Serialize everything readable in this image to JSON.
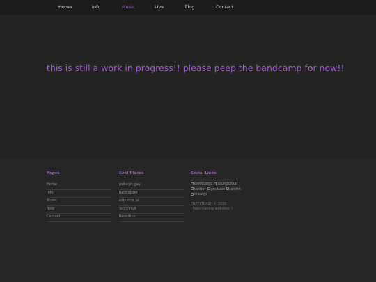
{
  "nav": {
    "items": [
      {
        "label": "Home",
        "active": false
      },
      {
        "label": "Info",
        "active": false
      },
      {
        "label": "Music",
        "active": true
      },
      {
        "label": "Live",
        "active": false
      },
      {
        "label": "Blog",
        "active": false
      },
      {
        "label": "Contact",
        "active": false
      }
    ]
  },
  "hero": {
    "text": "this is still a work in progress!! please peep the bandcamp for now!!"
  },
  "footer": {
    "pages": {
      "title": "Pages",
      "items": [
        "Home",
        "Info",
        "Music",
        "Blog",
        "Contact"
      ]
    },
    "cool_places": {
      "title": "Cool Places",
      "items": [
        "psikeyis.gay",
        "Neocapser",
        "espurr.re.je",
        "Sonicyl64",
        "Neocities"
      ]
    },
    "social": {
      "title": "Social Links",
      "links": [
        "bandcamp",
        "soundcloud",
        "twitter",
        "youtube",
        "lastfm",
        "discogs"
      ],
      "copyright": "PUPPYTRASH © 2020",
      "tagline": "i hate making websites :)"
    }
  },
  "colors": {
    "accent": "#a155d6",
    "background": "#232323",
    "nav_background": "#1c1c1c",
    "footer_background": "#262626"
  }
}
